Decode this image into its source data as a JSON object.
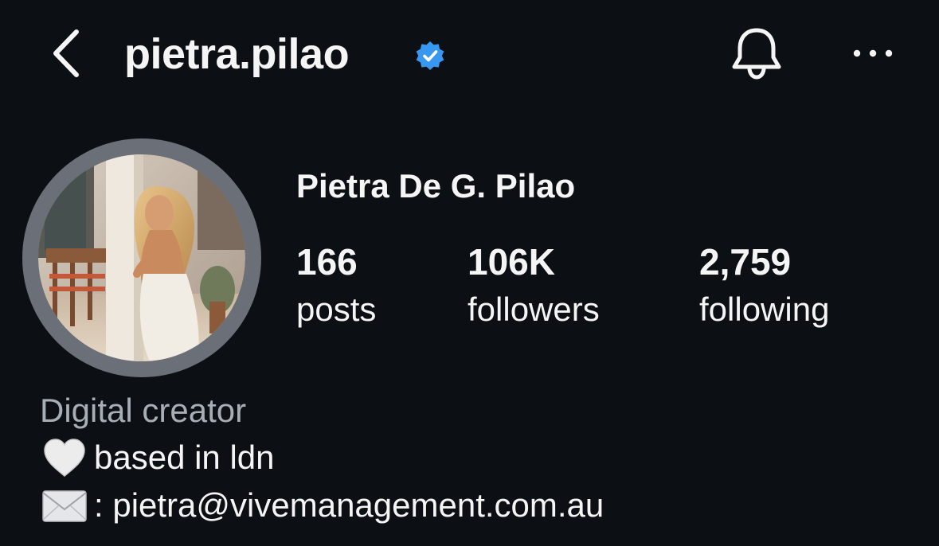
{
  "header": {
    "username": "pietra.pilao",
    "back_icon": "chevron-left-icon",
    "verified_icon": "verified-badge-icon",
    "bell_icon": "bell-icon",
    "more_icon": "more-horizontal-icon"
  },
  "profile": {
    "display_name": "Pietra De G. Pilao",
    "avatar_icon": "profile-photo"
  },
  "stats": {
    "posts": {
      "value": "166",
      "label": "posts"
    },
    "followers": {
      "value": "106K",
      "label": "followers"
    },
    "following": {
      "value": "2,759",
      "label": "following"
    }
  },
  "bio": {
    "category": "Digital creator",
    "line1_icon": "white-heart-icon",
    "line1_text": "based in ldn",
    "line2_icon": "envelope-icon",
    "line2_text": ": pietra@vivemanagement.com.au"
  },
  "colors": {
    "background": "#0c1014",
    "text": "#f5f5f5",
    "muted_text": "#a8aeb6",
    "verified_blue": "#3897f0",
    "avatar_ring": "#6b7078"
  }
}
